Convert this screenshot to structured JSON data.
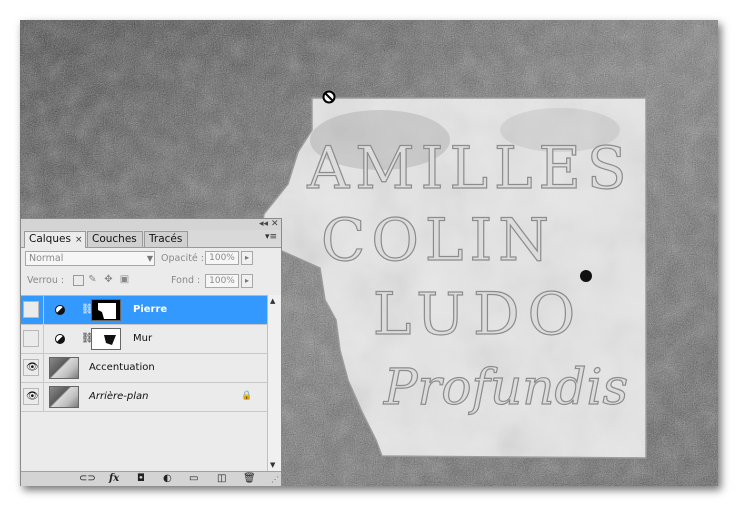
{
  "photo": {
    "plaque_lines": [
      "AMILLES",
      "COLIN",
      "LUDO",
      "Profundis"
    ]
  },
  "panel": {
    "tabs": [
      {
        "label": "Calques",
        "active": true,
        "close": "×"
      },
      {
        "label": "Couches",
        "active": false
      },
      {
        "label": "Tracés",
        "active": false
      }
    ],
    "menu_icon": "▾≡",
    "title_controls": "◂◂ ✕",
    "blend_mode": "Normal",
    "opacity_label": "Opacité :",
    "opacity_value": "100%",
    "lock_label": "Verrou :",
    "fill_label": "Fond :",
    "fill_value": "100%",
    "layers": [
      {
        "name": "Pierre",
        "visible": false,
        "selected": true,
        "has_mask": true,
        "italic": false
      },
      {
        "name": "Mur",
        "visible": false,
        "selected": false,
        "has_mask": true,
        "italic": false
      },
      {
        "name": "Accentuation",
        "visible": true,
        "selected": false,
        "has_mask": false,
        "italic": false
      },
      {
        "name": "Arrière-plan",
        "visible": true,
        "selected": false,
        "has_mask": false,
        "italic": true,
        "locked": true
      }
    ],
    "bottom_icons": [
      "link-icon",
      "fx-icon",
      "mask-icon",
      "adjustment-icon",
      "folder-icon",
      "new-layer-icon",
      "trash-icon"
    ],
    "fx_label": "fx"
  },
  "colors": {
    "selection": "#3399ff",
    "panel_bg": "#ebebeb"
  }
}
